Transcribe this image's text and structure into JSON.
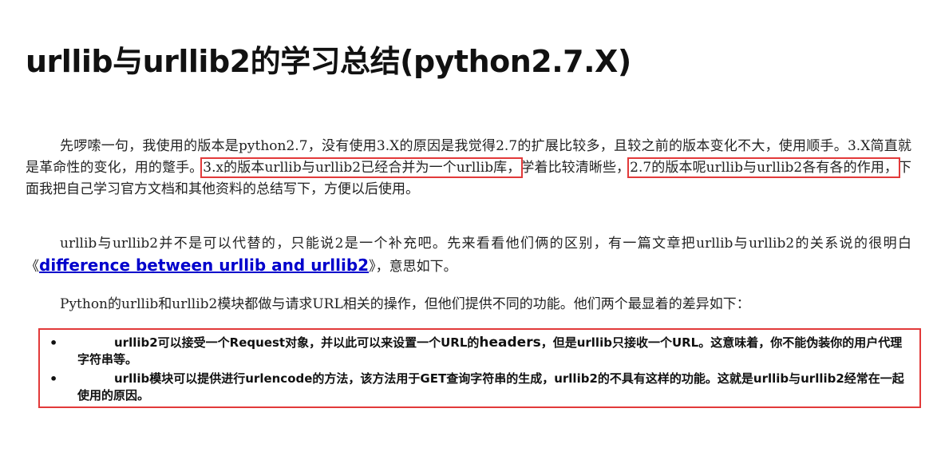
{
  "title": "urllib与urllib2的学习总结(python2.7.X)",
  "p1": {
    "t1": "先啰嗦一句，我使用的版本是python2.7，没有使用3.X的原因是我觉得2.7的扩展比较多，且较之前的版本变化不大，使用顺手。3.X简直就是革命性的变化，用的蹩手。",
    "h1": "3.x的版本urllib与urllib2已经合并为一个urllib库，",
    "t2": "学着比较清晰些，",
    "h2": "2.7的版本呢urllib与urllib2各有各的作用，",
    "t3": "下面我把自己学习官方文档和其他资料的总结写下，方便以后使用。"
  },
  "p2": {
    "t1": "urllib与urllib2并不是可以代替的，只能说2是一个补充吧。先来看看他们俩的区别，有一篇文章把urllib与urllib2的关系说的很明白《",
    "link": "difference between urllib and urllib2",
    "t2": "》，意思如下。"
  },
  "p3": "Python的urllib和urllib2模块都做与请求URL相关的操作，但他们提供不同的功能。他们两个最显着的差异如下：",
  "bullet_symbol": "•",
  "list": {
    "item1": {
      "a": "urllib2可以接受一个Request对象，并以此可以来设置一个URL的",
      "b": "headers",
      "c": "，但是urllib只接收一个URL。这意味着，你不能伪装你的用户代理字符串等。"
    },
    "item2": "urllib模块可以提供进行urlencode的方法，该方法用于GET查询字符串的生成，urllib2的不具有这样的功能。这就是urllib与urllib2经常在一起使用的原因。"
  },
  "colors": {
    "highlight_border": "#e23a3a",
    "link": "#0000cc"
  }
}
